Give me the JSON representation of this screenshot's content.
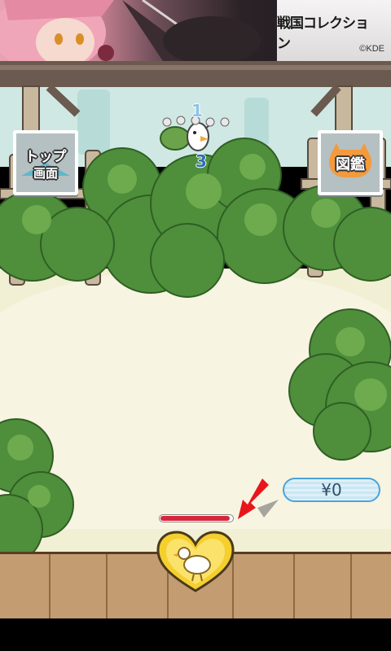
{
  "banner": {
    "logo_text": "戦国コレクション",
    "copyright": "©KDE"
  },
  "menu": {
    "top_button": {
      "line1": "トップ",
      "line2": "画面",
      "icon": "house-roof-icon"
    },
    "zukan_button": {
      "label": "図鑑",
      "icon": "cat-book-icon"
    }
  },
  "combo": {
    "num_top": "1",
    "num_bottom": "3"
  },
  "money": {
    "label": "¥0"
  },
  "player": {
    "hp_fraction": 0.97,
    "heart_icon": "bird-heart-icon"
  },
  "colors": {
    "hp": "#d4263c",
    "bush": "#4f8f3b",
    "bush_light": "#6dab4e",
    "arrow": "#e8161b"
  }
}
